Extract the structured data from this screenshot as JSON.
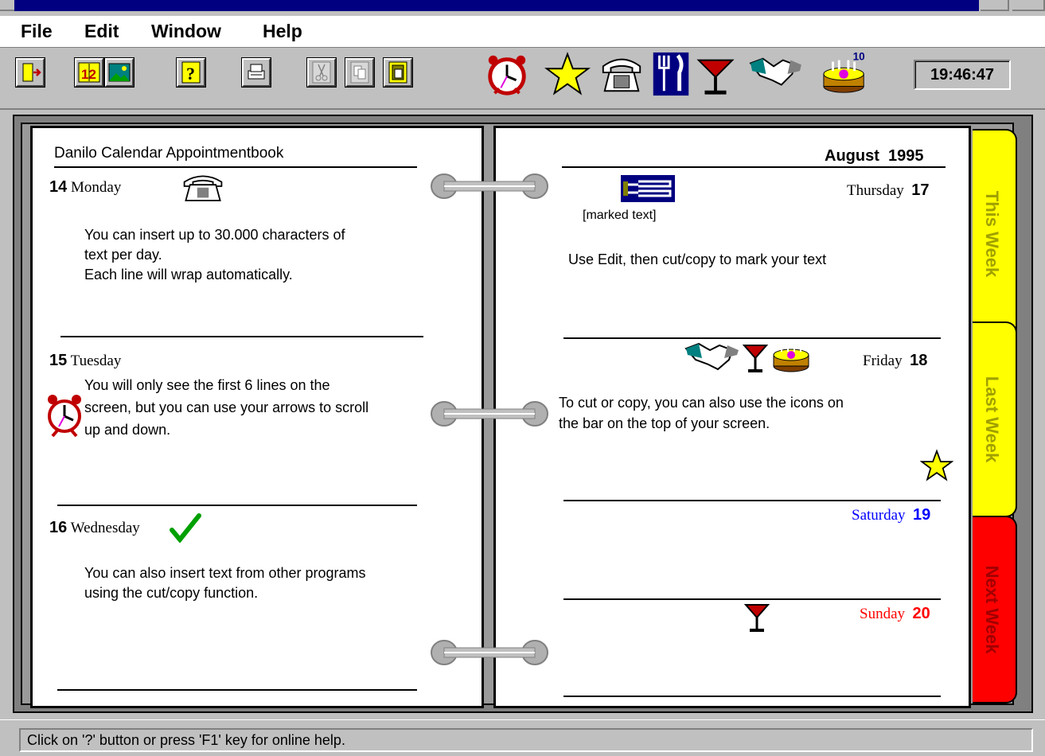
{
  "menu": {
    "file": "File",
    "edit": "Edit",
    "window": "Window",
    "help": "Help"
  },
  "toolbar": {
    "buttons": [
      "exit-icon",
      "calendar-pages-icon",
      "picture-icon",
      "help-icon",
      "printer-icon",
      "scissors-icon",
      "copy-icon",
      "paste-icon"
    ],
    "stamps": [
      "alarm-clock-icon",
      "star-icon",
      "telephone-icon",
      "fork-knife-icon",
      "cocktail-icon",
      "handshake-icon",
      "birthday-cake-icon"
    ],
    "cake_badge": "10",
    "clock": "19:46:47"
  },
  "left_page": {
    "title": "Danilo Calendar Appointmentbook",
    "days": [
      {
        "num": "14",
        "name": "Monday",
        "lines": [
          "You can insert up to 30.000 characters of",
          "text per day.",
          "Each line will wrap automatically."
        ]
      },
      {
        "num": "15",
        "name": "Tuesday",
        "lines": [
          "You will only see the first 6 lines on the",
          "screen, but you can use your arrows to scroll",
          "up and down."
        ]
      },
      {
        "num": "16",
        "name": "Wednesday",
        "lines": [
          "You can also insert text from other programs",
          "using the cut/copy function."
        ]
      }
    ]
  },
  "right_page": {
    "month": "August  1995",
    "days": [
      {
        "num": "17",
        "name": "Thursday",
        "caption": "[marked text]",
        "lines": [
          "Use Edit, then cut/copy to mark your text"
        ]
      },
      {
        "num": "18",
        "name": "Friday",
        "lines": [
          "To cut or copy, you can also use the icons on",
          "the bar on the top of your screen."
        ]
      },
      {
        "num": "19",
        "name": "Saturday"
      },
      {
        "num": "20",
        "name": "Sunday"
      }
    ]
  },
  "tabs": {
    "this_week": "This Week",
    "last_week": "Last Week",
    "next_week": "Next Week"
  },
  "colors": {
    "tab_yellow": "#ffff00",
    "tab_red": "#ff0000",
    "saturday_blue": "#0000ff",
    "sunday_red": "#ff0000",
    "this_week_text": "#a0a000",
    "next_week_text": "#a00000"
  },
  "status": {
    "text": "Click on '?' button or press 'F1' key for online help."
  }
}
